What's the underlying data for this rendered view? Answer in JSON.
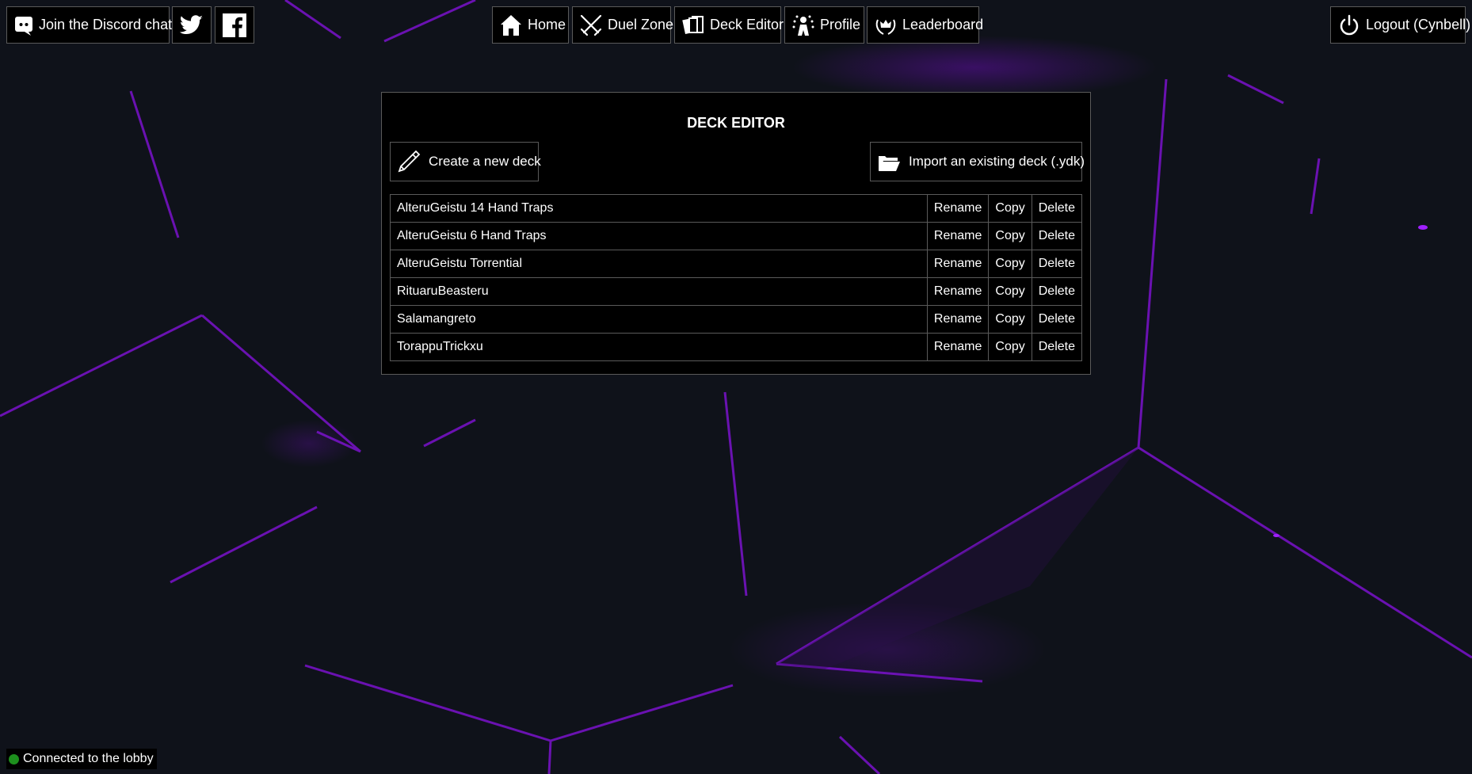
{
  "colors": {
    "background": "#0f121a",
    "accent": "#8a16e0",
    "panel": "#000000",
    "border": "#5a5a5a",
    "status_ok": "#1d8f1d"
  },
  "topbar": {
    "discord_label": "Join the Discord chat",
    "twitter_icon": "twitter-icon",
    "facebook_icon": "facebook-icon",
    "nav": {
      "home": "Home",
      "duel_zone": "Duel Zone",
      "deck_editor": "Deck Editor",
      "profile": "Profile",
      "leaderboard": "Leaderboard"
    },
    "logout_label": "Logout (Cynbell)"
  },
  "panel": {
    "title": "DECK EDITOR",
    "create_label": "Create a new deck",
    "import_label": "Import an existing deck (.ydk)"
  },
  "decks": [
    {
      "name": "AlteruGeistu 14 Hand Traps"
    },
    {
      "name": "AlteruGeistu 6 Hand Traps"
    },
    {
      "name": "AlteruGeistu Torrential"
    },
    {
      "name": "RituaruBeasteru"
    },
    {
      "name": "Salamangreto"
    },
    {
      "name": "TorappuTrickxu"
    }
  ],
  "actions": {
    "rename": "Rename",
    "copy": "Copy",
    "delete": "Delete"
  },
  "status": {
    "text": "Connected to the lobby"
  }
}
